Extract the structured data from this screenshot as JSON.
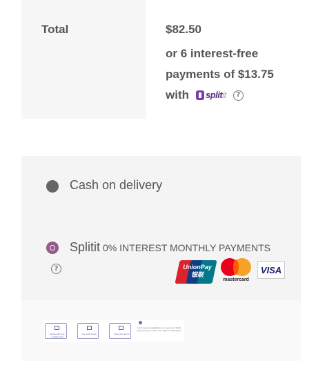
{
  "totals": {
    "label": "Total",
    "amount": "$82.50",
    "installments_text": "or 6 interest-free payments of $13.75",
    "with_text": "with",
    "splitit_logo_text": "split",
    "splitit_logo_suffix": "it",
    "help_glyph": "?"
  },
  "payment": {
    "methods": [
      {
        "label": "Cash on delivery",
        "selected": false
      },
      {
        "label": "Splitit",
        "sublabel": "0% INTEREST MONTHLY PAYMENTS",
        "selected": true
      }
    ],
    "help_glyph": "?",
    "card_logos": {
      "unionpay": "UnionPay 银联",
      "mastercard": "mastercard",
      "visa": "VISA"
    },
    "accent_color": "#96588a"
  },
  "info_strip": {
    "steps": [
      {
        "icon": "card-icon",
        "text": "Works with your existing card"
      },
      {
        "icon": "document-icon",
        "text": "No credit check"
      },
      {
        "icon": "calendar-icon",
        "text": "Know your terms"
      }
    ],
    "note": "You'll need an available line on your card. Splitit payment terms on file. Your payment information."
  }
}
